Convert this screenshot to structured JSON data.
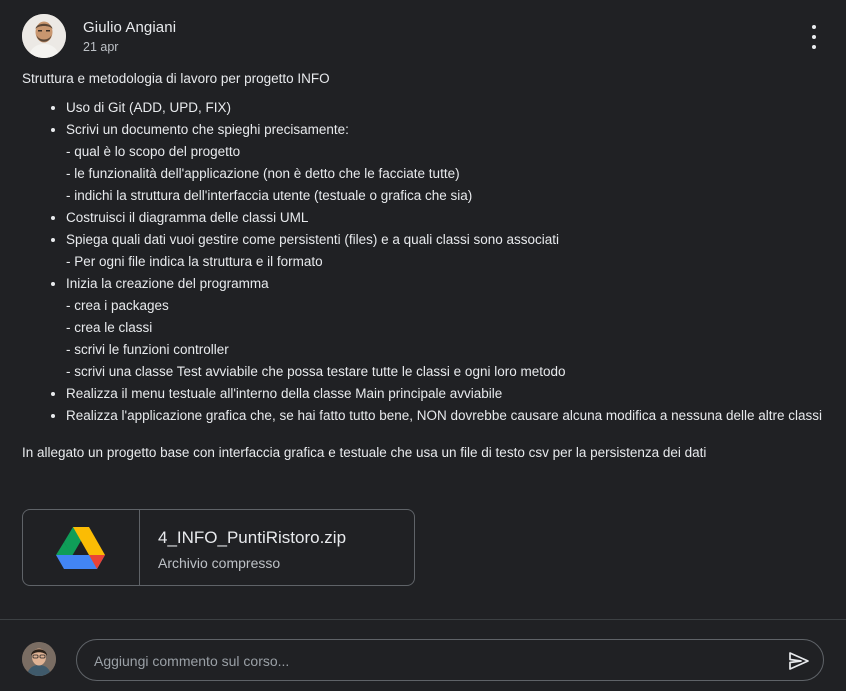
{
  "post": {
    "author": "Giulio Angiani",
    "date": "21 apr",
    "intro": "Struttura e metodologia di lavoro per progetto INFO",
    "items": [
      {
        "text": "Uso di Git (ADD, UPD, FIX)",
        "subs": []
      },
      {
        "text": "Scrivi un documento che spieghi precisamente:",
        "subs": [
          "- qual è lo scopo del progetto",
          "- le funzionalità dell'applicazione (non è detto che le facciate tutte)",
          "- indichi la struttura dell'interfaccia utente (testuale o grafica che sia)"
        ]
      },
      {
        "text": "Costruisci il diagramma delle classi UML",
        "subs": []
      },
      {
        "text": "Spiega quali dati vuoi gestire come persistenti (files) e a quali classi sono associati",
        "subs": [
          "- Per ogni file indica la struttura e il formato"
        ]
      },
      {
        "text": "Inizia la creazione del programma",
        "subs": [
          "- crea i packages",
          "- crea le classi",
          "- scrivi le funzioni controller",
          "- scrivi una classe Test avviabile che possa testare tutte le classi e ogni loro metodo"
        ]
      },
      {
        "text": "Realizza il menu testuale all'interno della classe Main principale avviabile",
        "subs": []
      },
      {
        "text": "Realizza l'applicazione grafica che, se hai fatto tutto bene, NON dovrebbe causare alcuna modifica a nessuna delle altre classi",
        "subs": []
      }
    ],
    "closing": "In allegato un progetto base con interfaccia grafica e testuale che usa un file di testo csv per la persistenza dei dati"
  },
  "attachment": {
    "name": "4_INFO_PuntiRistoro.zip",
    "type": "Archivio compresso",
    "icon": "google-drive-icon"
  },
  "comment": {
    "placeholder": "Aggiungi commento sul corso..."
  },
  "icons": {
    "more": "more-vert-icon",
    "send": "send-icon"
  },
  "colors": {
    "background": "#202124",
    "text": "#e8eaed",
    "muted": "#bdc1c6",
    "border": "#5f6368"
  }
}
